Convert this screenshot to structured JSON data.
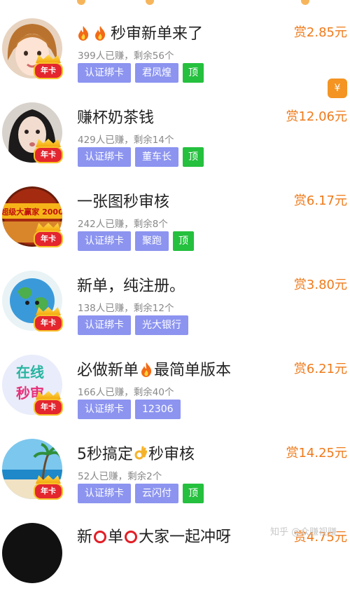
{
  "items": [
    {
      "title": "秒审新单来了",
      "reward": "赏2.85元",
      "stats": "399人已赚，剩余56个",
      "tags": [
        "认证绑卡",
        "君凤煌",
        "顶"
      ],
      "badge": "年卡"
    },
    {
      "title": "赚杯奶茶钱",
      "reward": "赏12.06元",
      "stats": "429人已赚，剩余14个",
      "tags": [
        "认证绑卡",
        "董车长",
        "顶"
      ],
      "badge": "年卡"
    },
    {
      "title": "一张图秒审核",
      "reward": "赏6.17元",
      "stats": "242人已赚，剩余8个",
      "tags": [
        "认证绑卡",
        "聚跑",
        "顶"
      ],
      "badge": "年卡",
      "avatar_text": "超级大赢家 2000"
    },
    {
      "title": "新单，纯注册。",
      "reward": "赏3.80元",
      "stats": "138人已赚，剩余12个",
      "tags": [
        "认证绑卡",
        "光大银行"
      ],
      "badge": "年卡"
    },
    {
      "title_a": "必做新单",
      "title_b": "最简单版本",
      "reward": "赏6.21元",
      "stats": "166人已赚，剩余40个",
      "tags": [
        "认证绑卡",
        "12306"
      ],
      "badge": "年卡",
      "avatar_text_1": "在线",
      "avatar_text_2": "秒审"
    },
    {
      "title_a": "5秒搞定",
      "title_b": "秒审核",
      "reward": "赏14.25元",
      "stats": "52人已赚，剩余2个",
      "tags": [
        "认证绑卡",
        "云闪付",
        "顶"
      ],
      "badge": "年卡"
    },
    {
      "title_a": "新",
      "title_b": "单",
      "title_c": "大家一起冲呀",
      "reward": "赏4.75元"
    }
  ],
  "side_icon": "¥",
  "watermark": "知乎 @众赚视赚",
  "icons": {
    "flame": "flame-icon",
    "ok": "ok-hand-icon",
    "ring": "red-circle-icon",
    "yen": "yen-icon"
  },
  "colors": {
    "reward": "#ef7a1a",
    "tag": "#8c94f0",
    "top_tag": "#25c03e",
    "badge": "#e4262e"
  }
}
